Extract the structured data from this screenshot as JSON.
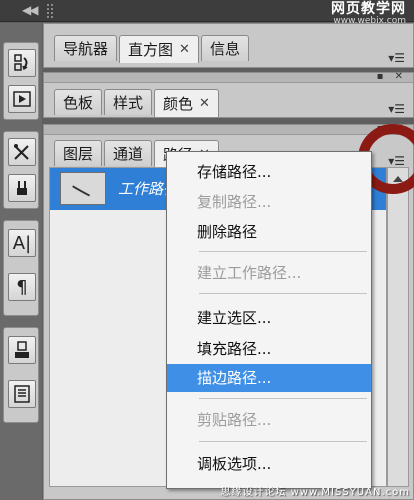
{
  "watermark": {
    "top_line1": "网页教学网",
    "top_line2": "www.webjx.com",
    "bottom": "思缘设计论坛 www.MISSYUAN.com"
  },
  "topbar": {
    "collapse_icon": "double-chevron-left-icon"
  },
  "panel_group_1": {
    "tabs": [
      {
        "label": "导航器",
        "closable": false
      },
      {
        "label": "直方图",
        "closable": true
      },
      {
        "label": "信息",
        "closable": false
      }
    ],
    "active_tab": 1
  },
  "panel_group_2": {
    "tabs": [
      {
        "label": "色板",
        "closable": false
      },
      {
        "label": "样式",
        "closable": false
      },
      {
        "label": "颜色",
        "closable": true
      }
    ],
    "active_tab": 2
  },
  "panel_group_3": {
    "tabs": [
      {
        "label": "图层",
        "closable": false
      },
      {
        "label": "通道",
        "closable": false
      },
      {
        "label": "路径",
        "closable": true
      }
    ],
    "active_tab": 2
  },
  "paths": {
    "items": [
      {
        "name": "工作路径"
      }
    ]
  },
  "context_menu": {
    "items": [
      {
        "label": "存储路径...",
        "enabled": true
      },
      {
        "label": "复制路径...",
        "enabled": false
      },
      {
        "label": "删除路径",
        "enabled": true
      },
      {
        "label": "建立工作路径...",
        "enabled": false
      },
      {
        "label": "建立选区...",
        "enabled": true
      },
      {
        "label": "填充路径...",
        "enabled": true
      },
      {
        "label": "描边路径...",
        "enabled": true,
        "highlighted": true
      },
      {
        "label": "剪贴路径...",
        "enabled": false
      },
      {
        "label": "调板选项...",
        "enabled": true
      }
    ]
  },
  "colors": {
    "selection_blue": "#2f7fd6",
    "menu_highlight": "#3f8fe6",
    "annotation_ring": "#8c1a14"
  }
}
